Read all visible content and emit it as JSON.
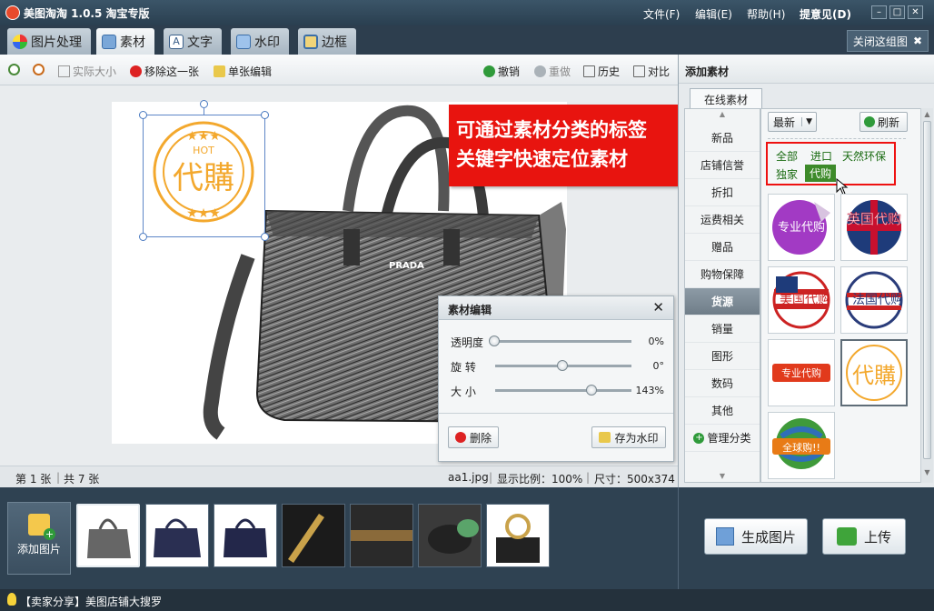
{
  "app": {
    "title": "美图淘淘 1.0.5 淘宝专版"
  },
  "menu": {
    "file": "文件(F)",
    "edit": "编辑(E)",
    "help": "帮助(H)",
    "feedback": "提意见(D)"
  },
  "tabs": [
    {
      "label": "图片处理"
    },
    {
      "label": "素材"
    },
    {
      "label": "文字"
    },
    {
      "label": "水印"
    },
    {
      "label": "边框"
    }
  ],
  "close_group": "关闭这组图",
  "toolbar": {
    "actual_size": "实际大小",
    "remove_one": "移除这一张",
    "single_edit": "单张编辑",
    "undo": "撤销",
    "redo": "重做",
    "history": "历史",
    "compare": "对比"
  },
  "status": {
    "page": "第 1 张",
    "total": "共 7 张",
    "filename": "aa1.jpg",
    "ratio": "显示比例：100%",
    "size": "尺寸：500x374"
  },
  "sticker": {
    "top_text": "HOT",
    "main_text": "代購"
  },
  "bag": {
    "brand": "PRADA"
  },
  "callout": {
    "line1": "可通过素材分类的标签",
    "line2": "关键字快速定位素材"
  },
  "edit_panel": {
    "title": "素材编辑",
    "sliders": [
      {
        "label": "透明度",
        "value": 0,
        "display": "0%"
      },
      {
        "label": "旋  转",
        "value": 0,
        "display": "0°"
      },
      {
        "label": "大  小",
        "value": 143,
        "display": "143%"
      }
    ],
    "delete_label": "删除",
    "save_watermark_label": "存为水印"
  },
  "right_panel": {
    "header": "添加素材",
    "online_tab": "在线素材",
    "categories": [
      "新品",
      "店铺信誉",
      "折扣",
      "运费相关",
      "赠品",
      "购物保障",
      "货源",
      "销量",
      "图形",
      "数码",
      "其他"
    ],
    "active_category": "货源",
    "manage_label": "管理分类",
    "sort_select": "最新",
    "refresh_label": "刷新",
    "tags": [
      "全部",
      "进口",
      "天然环保",
      "独家",
      "代购"
    ],
    "active_tag": "代购",
    "thumbs": [
      "专业代购",
      "英国代购",
      "美国代购",
      "法国代购",
      "专业代购",
      "代購",
      "全球购!!"
    ]
  },
  "filmstrip": {
    "add_label": "添加图片"
  },
  "actions": {
    "generate_label": "生成图片",
    "upload_label": "上传"
  },
  "tipbar": "【卖家分享】美图店铺大搜罗",
  "colors": {
    "accent_red": "#e8140f",
    "tag_green": "#3d8a2a",
    "titlebar": "#2d3e4e"
  }
}
